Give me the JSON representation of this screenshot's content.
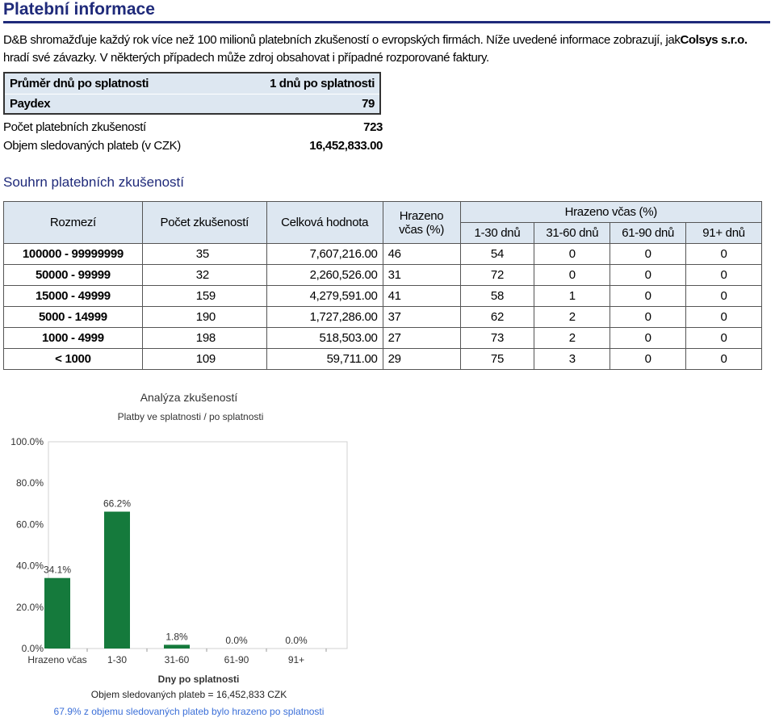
{
  "header": {
    "title": "Platební informace"
  },
  "intro": {
    "text_before": "D&B shromažďuje každý rok více než 100 milionů platebních zkušeností o evropských firmách. Níže uvedené informace zobrazují, jak",
    "company": "Colsys s.r.o.",
    "text_after": " hradí své závazky. V některých případech může zdroj obsahovat i případné rozporované faktury."
  },
  "summary_box": {
    "avg_label": "Průměr dnů po splatnosti",
    "avg_value": "1 dnů po splatnosti",
    "paydex_label": "Paydex",
    "paydex_value": "79"
  },
  "stats": {
    "count_label": "Počet platebních zkušeností",
    "count_value": "723",
    "volume_label": "Objem sledovaných plateb (v CZK)",
    "volume_value": "16,452,833.00"
  },
  "section_title": "Souhrn platebních zkušeností",
  "table": {
    "headers": {
      "range": "Rozmezí",
      "count": "Počet zkušeností",
      "total": "Celková hodnota",
      "ontime": "Hrazeno včas (%)",
      "group": "Hrazeno včas (%)",
      "b1": "1-30 dnů",
      "b2": "31-60 dnů",
      "b3": "61-90 dnů",
      "b4": "91+ dnů"
    },
    "rows": [
      {
        "range": "100000 - 99999999",
        "count": "35",
        "total": "7,607,216.00",
        "ontime": "46",
        "b1": "54",
        "b2": "0",
        "b3": "0",
        "b4": "0"
      },
      {
        "range": "50000 - 99999",
        "count": "32",
        "total": "2,260,526.00",
        "ontime": "31",
        "b1": "72",
        "b2": "0",
        "b3": "0",
        "b4": "0"
      },
      {
        "range": "15000 - 49999",
        "count": "159",
        "total": "4,279,591.00",
        "ontime": "41",
        "b1": "58",
        "b2": "1",
        "b3": "0",
        "b4": "0"
      },
      {
        "range": "5000 - 14999",
        "count": "190",
        "total": "1,727,286.00",
        "ontime": "37",
        "b1": "62",
        "b2": "2",
        "b3": "0",
        "b4": "0"
      },
      {
        "range": "1000 - 4999",
        "count": "198",
        "total": "518,503.00",
        "ontime": "27",
        "b1": "73",
        "b2": "2",
        "b3": "0",
        "b4": "0"
      },
      {
        "range": "< 1000",
        "count": "109",
        "total": "59,711.00",
        "ontime": "29",
        "b1": "75",
        "b2": "3",
        "b3": "0",
        "b4": "0"
      }
    ]
  },
  "chart_data": {
    "type": "bar",
    "title": "Analýza zkušeností",
    "subtitle": "Platby ve splatnosti / po splatnosti",
    "xlabel": "Dny po splatnosti",
    "ylabel": "",
    "categories": [
      "Hrazeno včas",
      "1-30",
      "31-60",
      "61-90",
      "91+"
    ],
    "values": [
      34.1,
      66.2,
      1.8,
      0.0,
      0.0
    ],
    "data_labels": [
      "34.1%",
      "66.2%",
      "1.8%",
      "0.0%",
      "0.0%"
    ],
    "ylim": [
      0,
      100
    ],
    "yticks": [
      "0.0%",
      "20.0%",
      "40.0%",
      "60.0%",
      "80.0%",
      "100.0%"
    ],
    "bar_color": "#157a3c",
    "note1": "Objem sledovaných plateb = 16,452,833 CZK",
    "note2": "67.9% z objemu sledovaných plateb bylo hrazeno po splatnosti",
    "note2_color": "#3b6fd8"
  }
}
